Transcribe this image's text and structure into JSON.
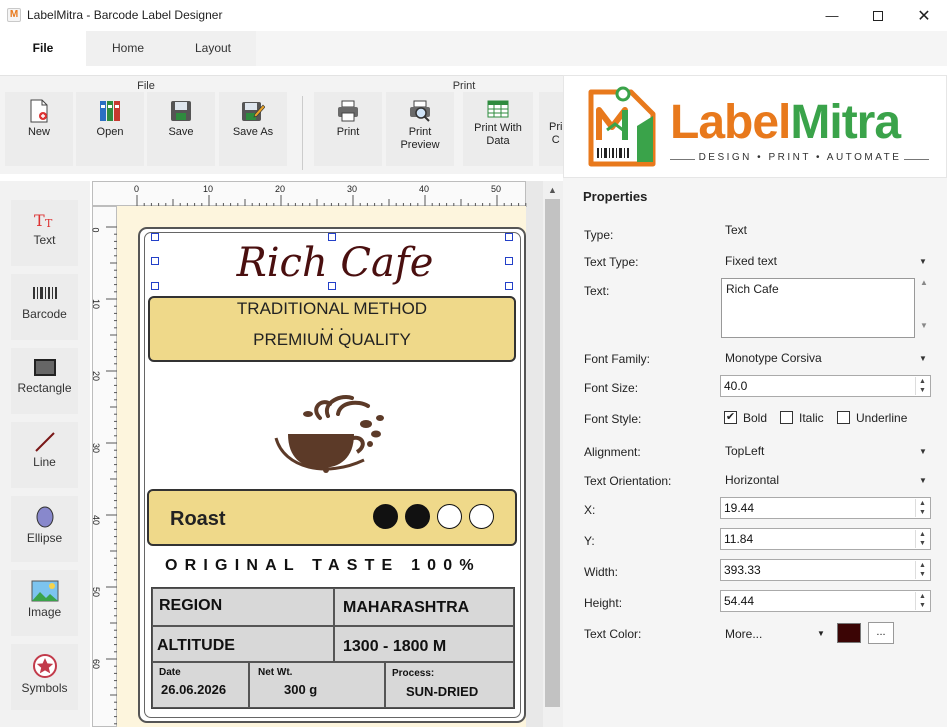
{
  "window": {
    "title": "LabelMitra - Barcode Label Designer"
  },
  "menu": {
    "tabs": [
      "File",
      "Home",
      "Layout"
    ]
  },
  "ribbon": {
    "groups": {
      "file": "File",
      "print": "Print"
    },
    "buttons": {
      "new": "New",
      "open": "Open",
      "save": "Save",
      "save_as": "Save As",
      "print": "Print",
      "print_preview": "Print\nPreview",
      "print_with_data": "Print With\nData",
      "print_cut": "Pri\nC"
    }
  },
  "logo": {
    "brand_left": "Label",
    "brand_right": "Mitra",
    "tagline": "DESIGN • PRINT • AUTOMATE"
  },
  "toolbox": {
    "items": [
      "Text",
      "Barcode",
      "Rectangle",
      "Line",
      "Ellipse",
      "Image",
      "Symbols"
    ]
  },
  "ruler": {
    "h_ticks": [
      "0",
      "10",
      "20",
      "30",
      "40",
      "50"
    ],
    "v_ticks": [
      "0",
      "10",
      "20",
      "30",
      "40",
      "50",
      "60"
    ]
  },
  "label": {
    "title": "Rich Cafe",
    "method_line1": "TRADITIONAL METHOD",
    "method_dots": ". . .",
    "method_line2": "PREMIUM QUALITY",
    "roast": "Roast",
    "roast_level": 2,
    "roast_max": 4,
    "tagline": "ORIGINAL TASTE 100%",
    "region_label": "REGION",
    "region_value": "MAHARASHTRA",
    "altitude_label": "ALTITUDE",
    "altitude_value": "1300 - 1800 M",
    "date_label": "Date",
    "date_value": "26.06.2026",
    "netwt_label": "Net Wt.",
    "netwt_value": "300 g",
    "process_label": "Process:",
    "process_value": "SUN-DRIED"
  },
  "properties": {
    "title": "Properties",
    "type_label": "Type:",
    "type_value": "Text",
    "text_type_label": "Text Type:",
    "text_type_value": "Fixed text",
    "text_label": "Text:",
    "text_value": "Rich Cafe",
    "font_family_label": "Font Family:",
    "font_family_value": "Monotype Corsiva",
    "font_size_label": "Font Size:",
    "font_size_value": "40.0",
    "font_style_label": "Font Style:",
    "bold_label": "Bold",
    "italic_label": "Italic",
    "underline_label": "Underline",
    "bold_checked": true,
    "italic_checked": false,
    "underline_checked": false,
    "alignment_label": "Alignment:",
    "alignment_value": "TopLeft",
    "orientation_label": "Text Orientation:",
    "orientation_value": "Horizontal",
    "x_label": "X:",
    "x_value": "19.44",
    "y_label": "Y:",
    "y_value": "11.84",
    "width_label": "Width:",
    "width_value": "393.33",
    "height_label": "Height:",
    "height_value": "54.44",
    "color_label": "Text Color:",
    "color_value": "More...",
    "color_button": "...",
    "text_color_hex": "#3b0505"
  },
  "colors": {
    "accent_orange": "#e8791c",
    "accent_green": "#3aa34a",
    "label_tan": "#efd98a",
    "selection_blue": "#2340c8"
  }
}
